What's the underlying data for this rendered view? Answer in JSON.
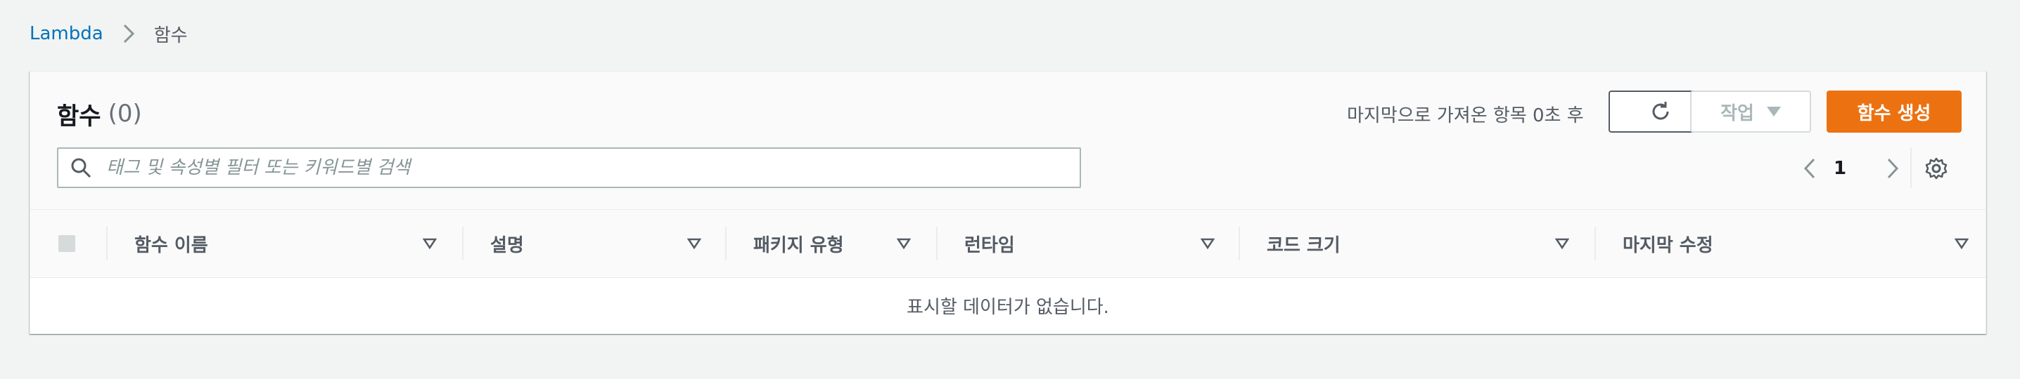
{
  "breadcrumb": {
    "root": "Lambda",
    "current": "함수"
  },
  "panel": {
    "title": "함수",
    "count": "(0)",
    "last_fetched": "마지막으로 가져온 항목 0초 후",
    "actions_label": "작업",
    "create_label": "함수 생성"
  },
  "search": {
    "placeholder": "태그 및 속성별 필터 또는 키워드별 검색",
    "value": ""
  },
  "pagination": {
    "page": "1"
  },
  "table": {
    "columns": [
      "함수 이름",
      "설명",
      "패키지 유형",
      "런타임",
      "코드 크기",
      "마지막 수정"
    ],
    "empty_text": "표시할 데이터가 없습니다."
  },
  "colors": {
    "accent": "#ec7211",
    "link": "#0073bb",
    "background": "#f2f3f3"
  },
  "icons": {
    "breadcrumb_separator": "chevron-right-icon",
    "refresh": "refresh-icon",
    "actions_dropdown": "caret-down-icon",
    "search": "search-icon",
    "prev_page": "chevron-left-icon",
    "next_page": "chevron-right-icon",
    "settings": "gear-icon",
    "sort": "sort-caret-icon"
  }
}
